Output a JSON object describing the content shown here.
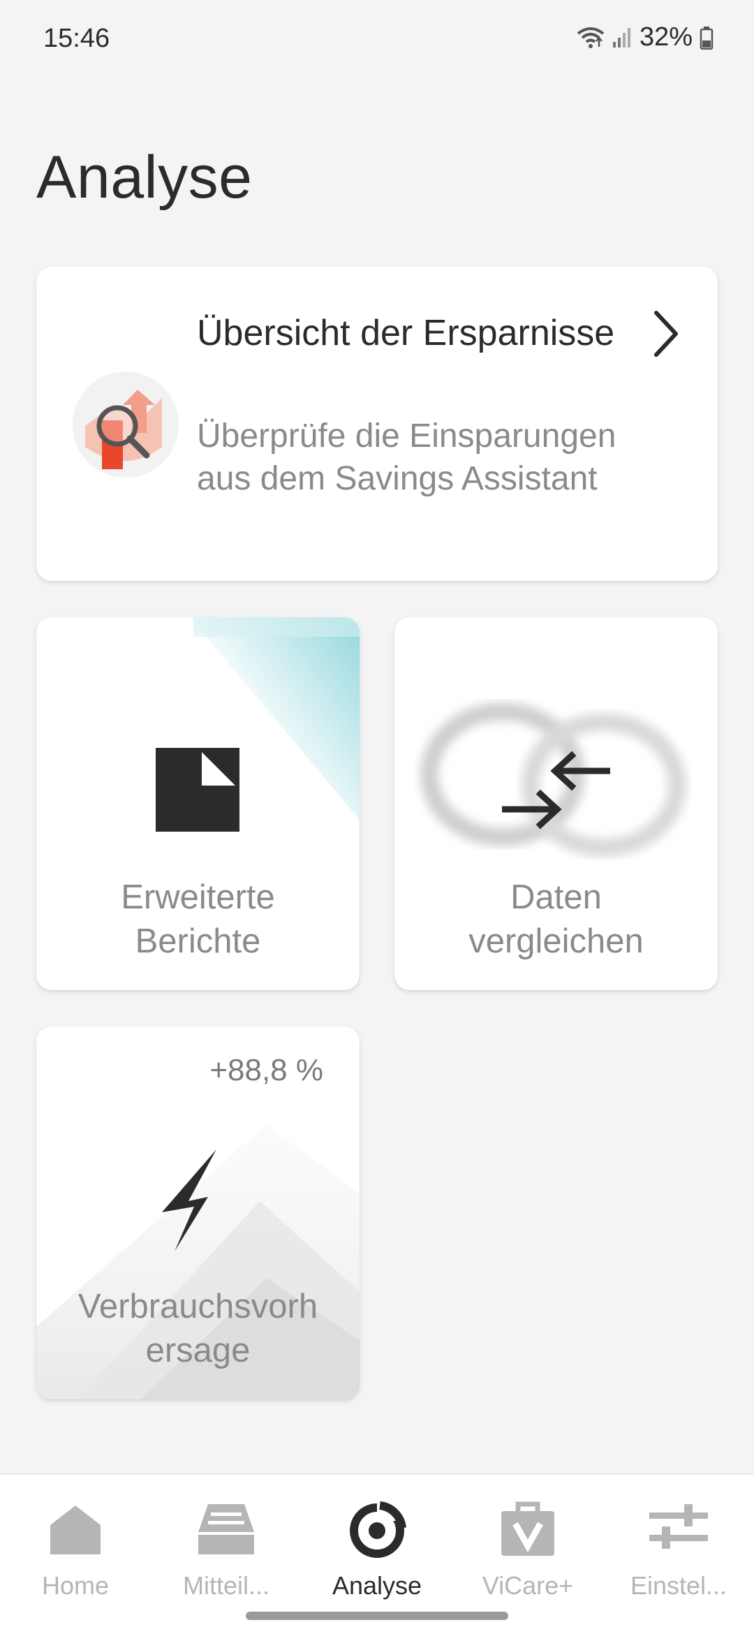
{
  "status_bar": {
    "time": "15:46",
    "battery": "32%",
    "icons": [
      "wifi-icon",
      "signal-icon",
      "battery-icon"
    ]
  },
  "page": {
    "title": "Analyse"
  },
  "savings_card": {
    "title": "Übersicht der Ersparnisse",
    "subtitle": "Überprüfe die Einsparungen aus dem Savings Assistant",
    "icon": "savings-magnifier-icon",
    "action_icon": "chevron-right-icon"
  },
  "tiles": {
    "reports": {
      "label": "Erweiterte Berichte",
      "icon": "report-icon"
    },
    "compare": {
      "label": "Daten vergleichen",
      "icon": "compare-arrows-icon"
    },
    "forecast": {
      "label": "Verbrauchsvorhersage",
      "badge": "+88,8 %",
      "icon": "lightning-icon"
    }
  },
  "bottom_nav": {
    "items": [
      {
        "label": "Home",
        "icon": "home-icon",
        "active": false
      },
      {
        "label": "Mitteil...",
        "icon": "inbox-icon",
        "active": false
      },
      {
        "label": "Analyse",
        "icon": "analysis-icon",
        "active": true
      },
      {
        "label": "ViCare+",
        "icon": "vicare-bag-icon",
        "active": false
      },
      {
        "label": "Einstel...",
        "icon": "sliders-icon",
        "active": false
      }
    ]
  },
  "colors": {
    "background": "#f4f4f4",
    "card": "#ffffff",
    "text_primary": "#2b2b2b",
    "text_secondary": "#8a8a8a",
    "nav_inactive": "#b5b5b5",
    "accent_red": "#e8563b",
    "accent_teal": "#7fd0d8"
  }
}
